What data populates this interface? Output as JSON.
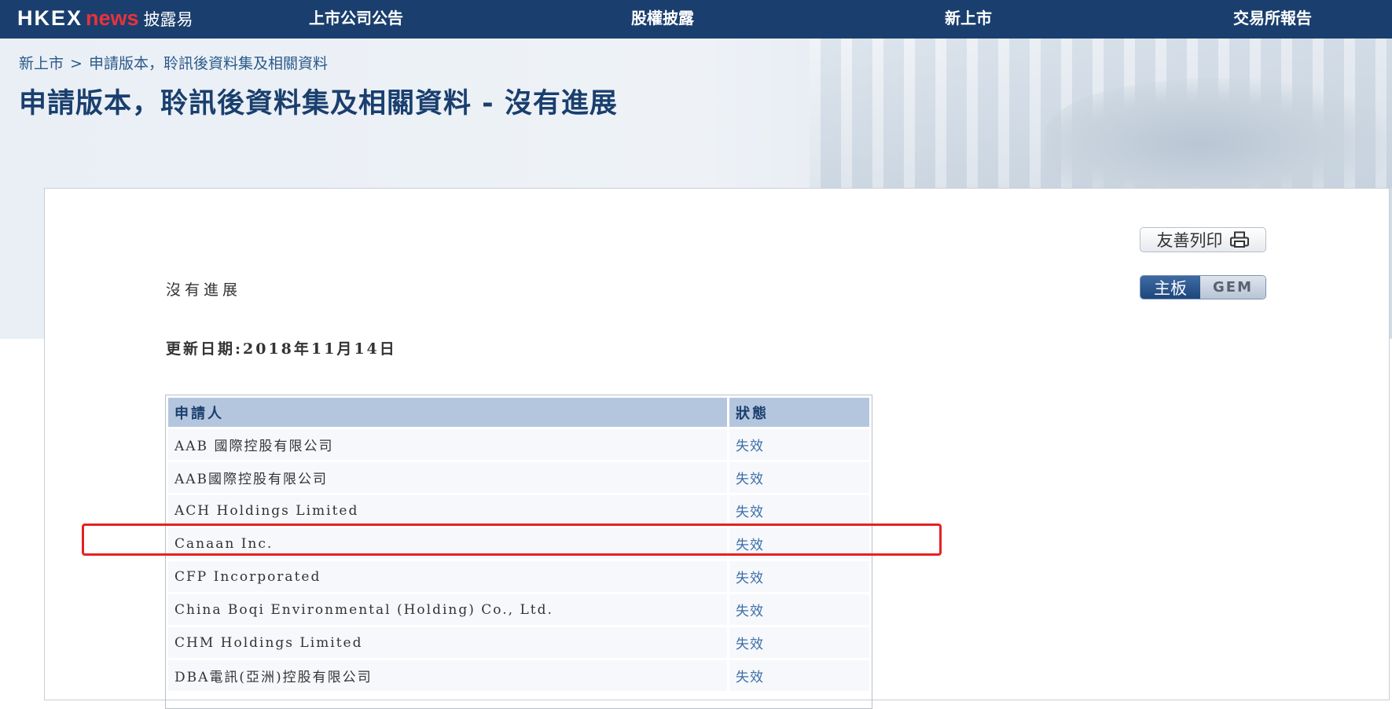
{
  "header": {
    "logo_main": "HKEX",
    "logo_news": "news",
    "logo_sub": "披露易",
    "nav": [
      "上市公司公告",
      "股權披露",
      "新上市",
      "交易所報告"
    ]
  },
  "breadcrumb": [
    "新上市",
    "申請版本，聆訊後資料集及相關資料"
  ],
  "breadcrumb_sep": ">",
  "page_title": "申請版本，聆訊後資料集及相關資料 - 沒有進展",
  "toolbar": {
    "print_label": "友善列印",
    "board_main": "主板",
    "board_gem": "GEM"
  },
  "status_heading": "沒有進展",
  "update_date": "更新日期:2018年11月14日",
  "table": {
    "headers": [
      "申請人",
      "狀態"
    ],
    "rows": [
      [
        "AAB 國際控股有限公司",
        "失效"
      ],
      [
        "AAB國際控股有限公司",
        "失效"
      ],
      [
        "ACH Holdings Limited",
        "失效"
      ],
      [
        "Canaan Inc.",
        "失效"
      ],
      [
        "CFP Incorporated",
        "失效"
      ],
      [
        "China Boqi Environmental (Holding) Co., Ltd.",
        "失效"
      ],
      [
        "CHM Holdings Limited",
        "失效"
      ],
      [
        "DBA電訊(亞洲)控股有限公司",
        "失效"
      ]
    ]
  },
  "colors": {
    "nav_bg": "#1a3f6e",
    "accent_red": "#e52222",
    "table_header": "#b4c6de",
    "link_blue": "#3c6ea8"
  }
}
